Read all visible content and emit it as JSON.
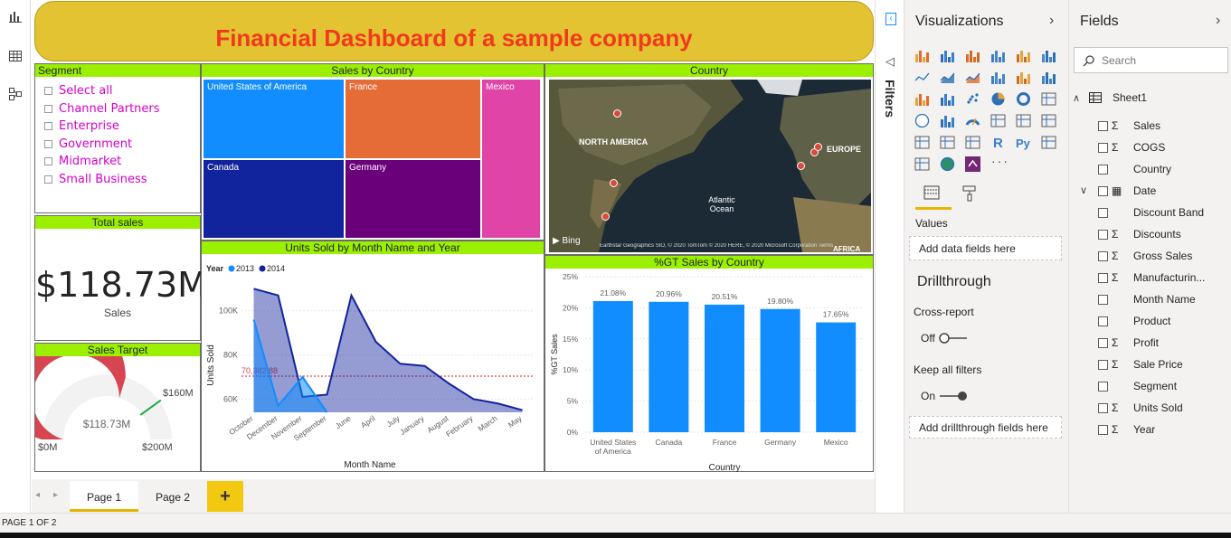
{
  "title": "Financial Dashboard of a sample company",
  "segment": {
    "header": "Segment",
    "items": [
      "Select all",
      "Channel Partners",
      "Enterprise",
      "Government",
      "Midmarket",
      "Small Business"
    ]
  },
  "total_sales": {
    "header": "Total sales",
    "value": "$118.73M",
    "label": "Sales"
  },
  "sales_target": {
    "header": "Sales Target",
    "value": "$118.73M",
    "min": "$0M",
    "max": "$200M",
    "target": "$160M",
    "fill_fraction": 0.5937,
    "target_fraction": 0.8
  },
  "treemap": {
    "header": "Sales by Country",
    "cells": [
      {
        "label": "United States of America",
        "color": "#118dff"
      },
      {
        "label": "France",
        "color": "#e66c37"
      },
      {
        "label": "Mexico",
        "color": "#e044a7"
      },
      {
        "label": "Canada",
        "color": "#12239e"
      },
      {
        "label": "Germany",
        "color": "#6b007b"
      }
    ]
  },
  "map": {
    "header": "Country",
    "labels": [
      "NORTH AMERICA",
      "EUROPE",
      "Atlantic Ocean",
      "AFRICA"
    ],
    "bing": "Bing",
    "attribution": "Earthstar Geographics SIO, © 2020 TomTom © 2020 HERE, © 2020 Microsoft Corporation Terms"
  },
  "area_chart_meta": {
    "header": "Units Sold by Month Name and Year",
    "legend_title": "Year",
    "avg_label": "70,382.88"
  },
  "bar_chart_meta": {
    "header": "%GT Sales by Country"
  },
  "chart_data": [
    {
      "type": "area",
      "title": "Units Sold by Month Name and Year",
      "xlabel": "Month Name",
      "ylabel": "Units Sold",
      "categories": [
        "October",
        "December",
        "November",
        "September",
        "June",
        "April",
        "July",
        "January",
        "August",
        "February",
        "March",
        "May"
      ],
      "yticks": [
        "60K",
        "80K",
        "100K"
      ],
      "ylim": [
        54000,
        113000
      ],
      "average": 70382.88,
      "series": [
        {
          "name": "2013",
          "color": "#118dff",
          "values": [
            96000,
            57000,
            70000,
            54000,
            null,
            null,
            null,
            null,
            null,
            null,
            null,
            null
          ]
        },
        {
          "name": "2014",
          "color": "#12239e",
          "values": [
            110000,
            107000,
            61000,
            62000,
            107000,
            86000,
            76000,
            75000,
            67000,
            60000,
            58000,
            55000
          ]
        }
      ]
    },
    {
      "type": "bar",
      "title": "%GT Sales by Country",
      "xlabel": "Country",
      "ylabel": "%GT Sales",
      "categories": [
        "United States of America",
        "Canada",
        "France",
        "Germany",
        "Mexico"
      ],
      "values": [
        21.08,
        20.96,
        20.51,
        19.8,
        17.65
      ],
      "value_labels": [
        "21.08%",
        "20.96%",
        "20.51%",
        "19.80%",
        "17.65%"
      ],
      "yticks": [
        "0%",
        "5%",
        "10%",
        "15%",
        "20%",
        "25%"
      ],
      "ylim": [
        0,
        25
      ],
      "color": "#118dff"
    }
  ],
  "filters_label": "Filters",
  "viz": {
    "title": "Visualizations",
    "values_label": "Values",
    "add_fields": "Add data fields here",
    "drillthrough": "Drillthrough",
    "cross_report": "Cross-report",
    "off": "Off",
    "keep_filters": "Keep all filters",
    "on": "On",
    "add_drill": "Add drillthrough fields here",
    "more": "···"
  },
  "fields": {
    "title": "Fields",
    "search_placeholder": "Search",
    "table": "Sheet1",
    "items": [
      {
        "name": "Sales",
        "sigma": true
      },
      {
        "name": "COGS",
        "sigma": true
      },
      {
        "name": "Country",
        "sigma": false
      },
      {
        "name": "Date",
        "sigma": false,
        "expand": true
      },
      {
        "name": "Discount Band",
        "sigma": false
      },
      {
        "name": "Discounts",
        "sigma": true
      },
      {
        "name": "Gross Sales",
        "sigma": true
      },
      {
        "name": "Manufacturin...",
        "sigma": true
      },
      {
        "name": "Month Name",
        "sigma": false
      },
      {
        "name": "Product",
        "sigma": false
      },
      {
        "name": "Profit",
        "sigma": true
      },
      {
        "name": "Sale Price",
        "sigma": true
      },
      {
        "name": "Segment",
        "sigma": false
      },
      {
        "name": "Units Sold",
        "sigma": true
      },
      {
        "name": "Year",
        "sigma": true
      }
    ]
  },
  "tabs": [
    "Page 1",
    "Page 2"
  ],
  "add_tab": "+",
  "status": "PAGE 1 OF 2"
}
